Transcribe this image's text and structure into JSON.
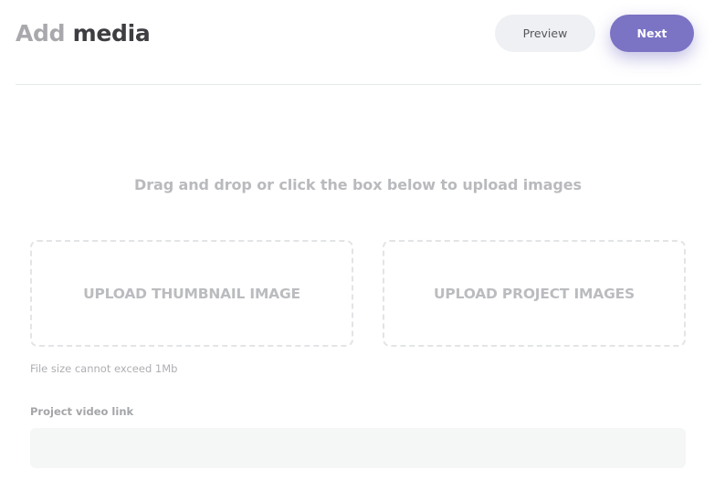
{
  "header": {
    "title_light": "Add",
    "title_dark": "media",
    "preview_label": "Preview",
    "next_label": "Next"
  },
  "upload": {
    "instruction": "Drag and drop or click the box below to upload images",
    "thumbnail_label": "UPLOAD THUMBNAIL IMAGE",
    "project_label": "UPLOAD PROJECT IMAGES",
    "size_hint": "File size cannot exceed 1Mb"
  },
  "video": {
    "label": "Project video link",
    "value": "",
    "placeholder": ""
  },
  "colors": {
    "accent": "#7b73c4",
    "secondary_button_bg": "#eef0f3",
    "dropzone_border": "#e3e4e6",
    "input_bg": "#f5f6f6"
  }
}
